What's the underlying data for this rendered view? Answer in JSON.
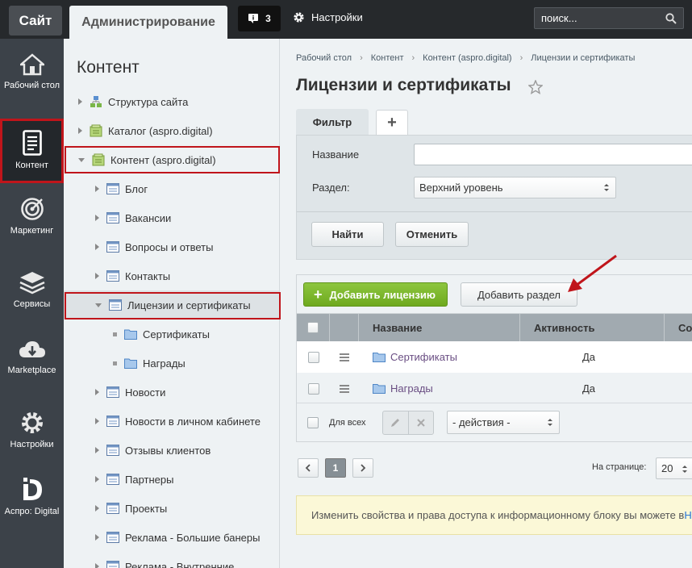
{
  "topbar": {
    "site_tab": "Сайт",
    "admin_tab": "Администрирование",
    "notifications_count": "3",
    "settings_label": "Настройки",
    "search_placeholder": "поиск..."
  },
  "leftnav": {
    "items": [
      {
        "label": "Рабочий стол",
        "icon": "home-icon"
      },
      {
        "label": "Контент",
        "icon": "document-icon",
        "active": true
      },
      {
        "label": "Маркетинг",
        "icon": "target-icon"
      },
      {
        "label": "Сервисы",
        "icon": "layers-icon"
      },
      {
        "label": "Marketplace",
        "icon": "cloud-download-icon"
      },
      {
        "label": "Настройки",
        "icon": "gear-icon"
      },
      {
        "label": "Аспро: Digital",
        "icon": "aspro-logo-icon"
      }
    ]
  },
  "tree": {
    "title": "Контент",
    "items": [
      {
        "label": "Структура сайта",
        "level": 0,
        "icon": "structure-icon"
      },
      {
        "label": "Каталог (aspro.digital)",
        "level": 0,
        "icon": "iblock-type-icon"
      },
      {
        "label": "Контент (aspro.digital)",
        "level": 0,
        "icon": "iblock-type-icon",
        "expanded": true
      },
      {
        "label": "Блог",
        "level": 1,
        "icon": "iblock-icon"
      },
      {
        "label": "Вакансии",
        "level": 1,
        "icon": "iblock-icon"
      },
      {
        "label": "Вопросы и ответы",
        "level": 1,
        "icon": "iblock-icon"
      },
      {
        "label": "Контакты",
        "level": 1,
        "icon": "iblock-icon"
      },
      {
        "label": "Лицензии и сертификаты",
        "level": 1,
        "icon": "iblock-icon",
        "expanded": true,
        "selected": true
      },
      {
        "label": "Сертификаты",
        "level": 2,
        "icon": "folder-icon"
      },
      {
        "label": "Награды",
        "level": 2,
        "icon": "folder-icon"
      },
      {
        "label": "Новости",
        "level": 1,
        "icon": "iblock-icon"
      },
      {
        "label": "Новости в личном кабинете",
        "level": 1,
        "icon": "iblock-icon"
      },
      {
        "label": "Отзывы клиентов",
        "level": 1,
        "icon": "iblock-icon"
      },
      {
        "label": "Партнеры",
        "level": 1,
        "icon": "iblock-icon"
      },
      {
        "label": "Проекты",
        "level": 1,
        "icon": "iblock-icon"
      },
      {
        "label": "Реклама - Большие банеры",
        "level": 1,
        "icon": "iblock-icon"
      },
      {
        "label": "Реклама - Внутренние",
        "level": 1,
        "icon": "iblock-icon"
      }
    ]
  },
  "breadcrumb": [
    "Рабочий стол",
    "Контент",
    "Контент (aspro.digital)",
    "Лицензии и сертификаты"
  ],
  "page_title": "Лицензии и сертификаты",
  "filter": {
    "tab_label": "Фильтр",
    "add_tab_label": "+",
    "name_label": "Название",
    "name_value": "",
    "section_label": "Раздел:",
    "section_value": "Верхний уровень",
    "find_button": "Найти",
    "cancel_button": "Отменить"
  },
  "list": {
    "add_license_button": "Добавить лицензию",
    "add_section_button": "Добавить раздел",
    "columns": [
      "Название",
      "Активность",
      "Со"
    ],
    "rows": [
      {
        "name": "Сертификаты",
        "active": "Да"
      },
      {
        "name": "Награды",
        "active": "Да"
      }
    ],
    "for_all_label": "Для всех",
    "actions_placeholder": "- действия -"
  },
  "pager": {
    "current_page": "1",
    "per_page_label": "На странице:",
    "per_page_value": "20"
  },
  "notice": {
    "text": "Изменить свойства и права доступа к информационному блоку вы можете в ",
    "link": "Н"
  },
  "colors": {
    "accent_red": "#c0151b",
    "green_button": "#7cb82f",
    "topbar": "#26292c",
    "leftnav": "#3c4249"
  }
}
